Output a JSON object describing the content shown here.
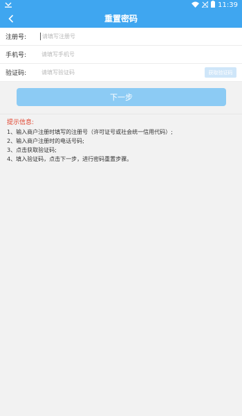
{
  "status_bar": {
    "time": "11:39",
    "icons": [
      "download-icon",
      "wifi-icon",
      "no-signal-icon",
      "battery-icon"
    ]
  },
  "header": {
    "title": "重置密码",
    "back_icon": "chevron-left-icon",
    "color": "#3fa6f0"
  },
  "form": {
    "rows": [
      {
        "label": "注册号:",
        "placeholder": "请填写注册号"
      },
      {
        "label": "手机号:",
        "placeholder": "请填写手机号"
      },
      {
        "label": "验证码:",
        "placeholder": "请填写验证码"
      }
    ],
    "get_code_label": "获取验证码"
  },
  "next_button_label": "下一步",
  "tips": {
    "title": "提示信息:",
    "items": [
      "1、输入商户注册时填写的注册号（许可证号或社会统一信用代码）;",
      "2、输入商户注册时的电话号码;",
      "3、点击获取验证码;",
      "4、填入验证码，点击下一步，进行密码重置步骤。"
    ],
    "title_color": "#e0402a"
  }
}
